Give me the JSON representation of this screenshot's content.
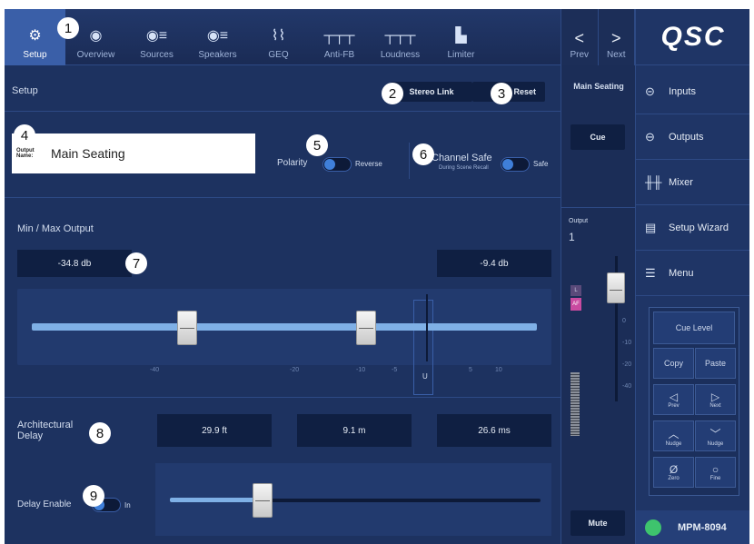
{
  "tabs": [
    {
      "label": "Setup",
      "icon": "gear-icon",
      "glyph": "⚙",
      "active": true
    },
    {
      "label": "Overview",
      "icon": "eye-icon",
      "glyph": "◉",
      "active": false
    },
    {
      "label": "Sources",
      "icon": "sources-icon",
      "glyph": "◉≡",
      "active": false
    },
    {
      "label": "Speakers",
      "icon": "speakers-icon",
      "glyph": "◉≡",
      "active": false
    },
    {
      "label": "GEQ",
      "icon": "geq-icon",
      "glyph": "⌇⌇",
      "active": false
    },
    {
      "label": "Anti-FB",
      "icon": "anti-fb-icon",
      "glyph": "┬┬┬",
      "active": false
    },
    {
      "label": "Loudness",
      "icon": "loudness-icon",
      "glyph": "┬┬┬",
      "active": false
    },
    {
      "label": "Limiter",
      "icon": "limiter-icon",
      "glyph": "▙",
      "active": false
    }
  ],
  "nav": {
    "prev": "Prev",
    "next": "Next",
    "prev_glyph": "<",
    "next_glyph": ">"
  },
  "setup": {
    "title": "Setup",
    "stereo_link": "Stereo Link",
    "reset": "Reset",
    "output_name_label": "Output Name:",
    "output_name_value": "Main Seating",
    "polarity_label": "Polarity",
    "polarity_toggle": "Reverse",
    "channel_safe_label": "Channel Safe",
    "channel_safe_sub": "During Scene Recall",
    "channel_safe_toggle": "Safe"
  },
  "minmax": {
    "title": "Min / Max Output",
    "min_value": "-34.8 db",
    "max_value": "-9.4 db",
    "scale": [
      "-40",
      "-20",
      "-10",
      "-5",
      "U",
      "5",
      "10"
    ],
    "u_label": "U"
  },
  "delay": {
    "title": "Architectural Delay",
    "feet": "29.9 ft",
    "meters": "9.1 m",
    "ms": "26.6 ms",
    "enable_label": "Delay Enable",
    "enable_toggle": "In",
    "slider_fraction": 0.25
  },
  "strip": {
    "name": "Main Seating",
    "cue": "Cue",
    "output_label": "Output",
    "output_number": "1",
    "l_badge": "L",
    "af_badge": "AF",
    "mute": "Mute",
    "fader_scale": [
      "0",
      "-10",
      "-20",
      "-40"
    ]
  },
  "brand": {
    "logo": "QSC"
  },
  "right_menu": [
    {
      "label": "Inputs",
      "icon": "input-icon",
      "glyph": "⊝"
    },
    {
      "label": "Outputs",
      "icon": "output-icon",
      "glyph": "⊖"
    },
    {
      "label": "Mixer",
      "icon": "mixer-icon",
      "glyph": "╫╫"
    },
    {
      "label": "Setup Wizard",
      "icon": "wizard-icon",
      "glyph": "▤"
    },
    {
      "label": "Menu",
      "icon": "menu-icon",
      "glyph": "☰"
    }
  ],
  "panel": {
    "cue_level": "Cue Level",
    "copy": "Copy",
    "paste": "Paste",
    "prev": "Prev",
    "next": "Next",
    "nudge_up": "Nudge",
    "nudge_down": "Nudge",
    "zero": "Zero",
    "fine": "Fine"
  },
  "device": {
    "name": "MPM-8094",
    "status_color": "#3ec46d"
  },
  "callouts": [
    "1",
    "2",
    "3",
    "4",
    "5",
    "6",
    "7",
    "8",
    "9"
  ],
  "colors": {
    "accent": "#3a5fa8",
    "slider": "#7fb0e6",
    "panel": "#1d3260"
  }
}
